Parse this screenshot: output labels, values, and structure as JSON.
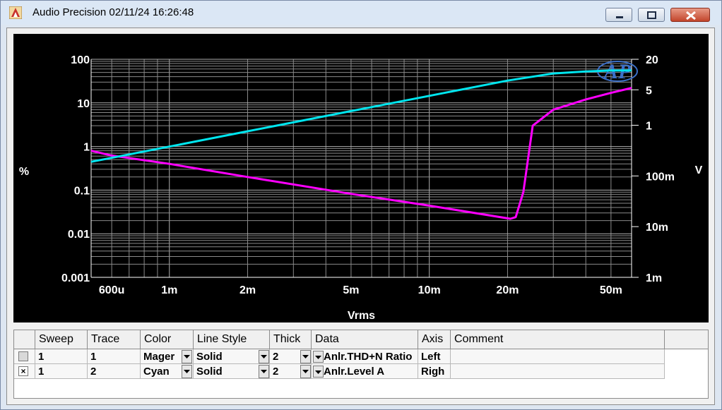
{
  "window": {
    "title": "Audio Precision  02/11/24 16:26:48"
  },
  "chart_data": {
    "type": "line",
    "title": "",
    "xlabel": "Vrms",
    "ylabel_left": "%",
    "ylabel_right": "V",
    "x_scale": "log",
    "y_scale": "log",
    "xlim": [
      0.0005,
      0.06
    ],
    "ylim_left": [
      0.001,
      100
    ],
    "ylim_right": [
      0.001,
      20
    ],
    "x_ticks": [
      {
        "v": 0.0006,
        "label": "600u"
      },
      {
        "v": 0.001,
        "label": "1m"
      },
      {
        "v": 0.002,
        "label": "2m"
      },
      {
        "v": 0.005,
        "label": "5m"
      },
      {
        "v": 0.01,
        "label": "10m"
      },
      {
        "v": 0.02,
        "label": "20m"
      },
      {
        "v": 0.05,
        "label": "50m"
      }
    ],
    "y_ticks_left": [
      {
        "v": 100,
        "label": "100"
      },
      {
        "v": 10,
        "label": "10"
      },
      {
        "v": 1,
        "label": "1"
      },
      {
        "v": 0.1,
        "label": "0.1"
      },
      {
        "v": 0.01,
        "label": "0.01"
      },
      {
        "v": 0.001,
        "label": "0.001"
      }
    ],
    "y_ticks_right": [
      {
        "v": 20,
        "label": "20"
      },
      {
        "v": 5,
        "label": "5"
      },
      {
        "v": 1,
        "label": "1"
      },
      {
        "v": 0.1,
        "label": "100m"
      },
      {
        "v": 0.01,
        "label": "10m"
      },
      {
        "v": 0.001,
        "label": "1m"
      }
    ],
    "grid": true,
    "logo_text": "AP",
    "series": [
      {
        "axis": "left",
        "color": "#ff00ff",
        "x": [
          0.0005,
          0.0006,
          0.001,
          0.002,
          0.005,
          0.01,
          0.018,
          0.0205,
          0.0215,
          0.023,
          0.025,
          0.03,
          0.04,
          0.05,
          0.06
        ],
        "y": [
          0.8,
          0.62,
          0.4,
          0.2,
          0.082,
          0.044,
          0.025,
          0.022,
          0.024,
          0.09,
          3.0,
          7.0,
          12.0,
          17.0,
          22.0
        ]
      },
      {
        "axis": "right",
        "color": "#00e5ee",
        "x": [
          0.0005,
          0.001,
          0.002,
          0.005,
          0.01,
          0.02,
          0.03,
          0.04,
          0.05,
          0.06
        ],
        "y": [
          0.19,
          0.38,
          0.76,
          1.9,
          3.8,
          7.6,
          10.5,
          11.5,
          12.0,
          12.0
        ]
      }
    ]
  },
  "table": {
    "headers": [
      "Sweep",
      "Trace",
      "Color",
      "Line Style",
      "Thick",
      "Data",
      "Axis",
      "Comment"
    ],
    "rows": [
      {
        "checked": "",
        "sweep": "1",
        "trace": "1",
        "color": "Mager",
        "line_style": "Solid",
        "thick": "2",
        "data": "Anlr.THD+N Ratio",
        "axis": "Left",
        "comment": ""
      },
      {
        "checked": "×",
        "sweep": "1",
        "trace": "2",
        "color": "Cyan",
        "line_style": "Solid",
        "thick": "2",
        "data": "Anlr.Level A",
        "axis": "Righ",
        "comment": ""
      }
    ]
  }
}
